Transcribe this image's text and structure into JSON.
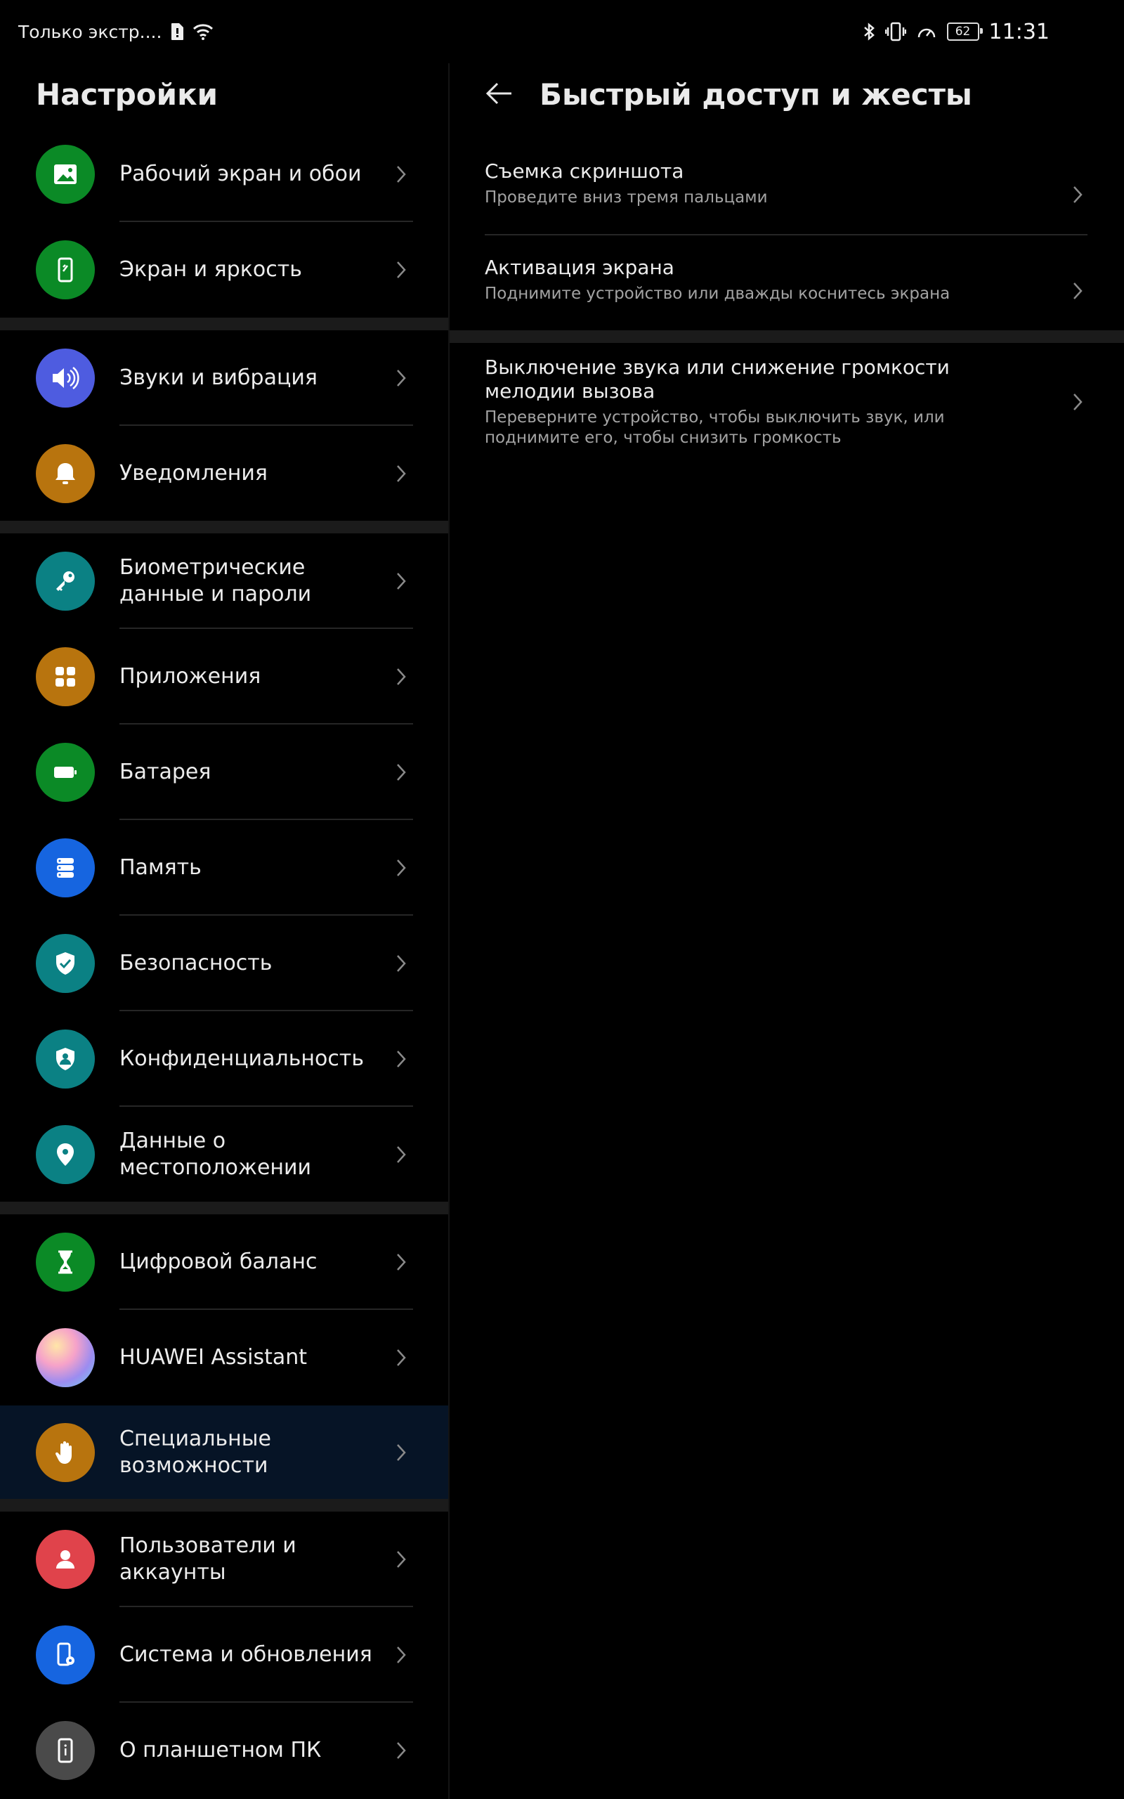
{
  "status_bar": {
    "carrier": "Только экстр....",
    "battery": "62",
    "time": "11:31"
  },
  "left_pane": {
    "title": "Настройки",
    "items": [
      {
        "label": "Рабочий экран и обои",
        "icon": "image-icon",
        "color": "#0b8a26"
      },
      {
        "label": "Экран и яркость",
        "icon": "phone-brightness-icon",
        "color": "#0b8a26"
      },
      {
        "label": "Звуки и вибрация",
        "icon": "speaker-icon",
        "color": "#4e5ce0"
      },
      {
        "label": "Уведомления",
        "icon": "bell-icon",
        "color": "#b8740e"
      },
      {
        "label": "Биометрические данные и пароли",
        "icon": "key-icon",
        "color": "#0b8184"
      },
      {
        "label": "Приложения",
        "icon": "apps-grid-icon",
        "color": "#b8740e"
      },
      {
        "label": "Батарея",
        "icon": "battery-icon",
        "color": "#0b8a26"
      },
      {
        "label": "Память",
        "icon": "storage-icon",
        "color": "#1665e0"
      },
      {
        "label": "Безопасность",
        "icon": "shield-check-icon",
        "color": "#0b8184"
      },
      {
        "label": "Конфиденциальность",
        "icon": "privacy-shield-icon",
        "color": "#0b8184"
      },
      {
        "label": "Данные о местоположении",
        "icon": "location-pin-icon",
        "color": "#0b8184"
      },
      {
        "label": "Цифровой баланс",
        "icon": "hourglass-icon",
        "color": "#0b8a26"
      },
      {
        "label": "HUAWEI Assistant",
        "icon": "assistant-orb-icon",
        "color": "#c9a4e8"
      },
      {
        "label": "Специальные возможности",
        "icon": "hand-icon",
        "color": "#b8740e"
      },
      {
        "label": "Пользователи и аккаунты",
        "icon": "user-icon",
        "color": "#e0434b"
      },
      {
        "label": "Система и обновления",
        "icon": "phone-gear-icon",
        "color": "#1665e0"
      },
      {
        "label": "О планшетном ПК",
        "icon": "phone-info-icon",
        "color": "#4a4a4a"
      }
    ]
  },
  "right_pane": {
    "title": "Быстрый доступ и жесты",
    "items": [
      {
        "title": "Съемка скриншота",
        "subtitle": "Проведите вниз тремя пальцами"
      },
      {
        "title": "Активация экрана",
        "subtitle": "Поднимите устройство или дважды коснитесь экрана"
      },
      {
        "title": "Выключение звука или снижение громкости мелодии вызова",
        "subtitle": "Переверните устройство, чтобы выключить звук, или поднимите его, чтобы снизить громкость"
      }
    ]
  }
}
